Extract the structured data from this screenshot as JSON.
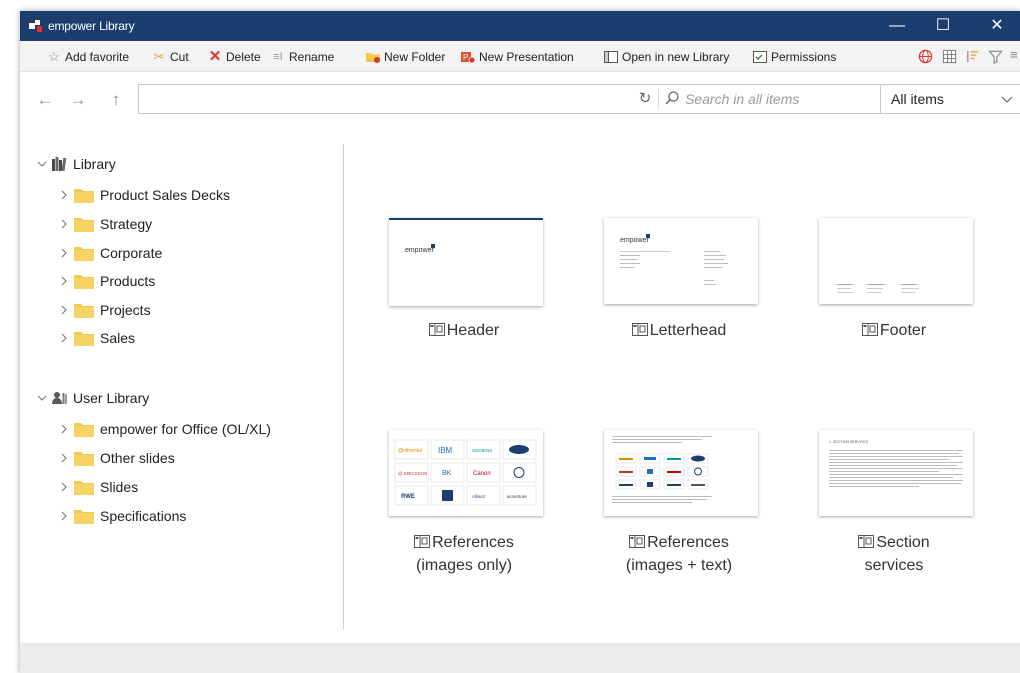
{
  "window": {
    "title": "empower Library"
  },
  "window_controls": {
    "minimize": "—",
    "maximize": "☐",
    "close": "✕"
  },
  "toolbar": {
    "add_favorite": "Add favorite",
    "cut": "Cut",
    "delete": "Delete",
    "rename": "Rename",
    "new_folder": "New Folder",
    "new_presentation": "New Presentation",
    "open_in_new_library": "Open in new Library",
    "permissions": "Permissions"
  },
  "address": {
    "path_value": "",
    "search_placeholder": "Search in all items",
    "filter_value": "All items"
  },
  "tree": {
    "library": {
      "label": "Library",
      "children": [
        "Product Sales Decks",
        "Strategy",
        "Corporate",
        "Products",
        "Projects",
        "Sales"
      ]
    },
    "user_library": {
      "label": "User Library",
      "children": [
        "empower for Office (OL/XL)",
        "Other slides",
        "Slides",
        "Specifications"
      ]
    }
  },
  "tiles": [
    {
      "line1": "Header",
      "line2": ""
    },
    {
      "line1": "Letterhead",
      "line2": ""
    },
    {
      "line1": "Footer",
      "line2": ""
    },
    {
      "line1": "References",
      "line2": "(images only)"
    },
    {
      "line1": "References",
      "line2": "(images + text)"
    },
    {
      "line1": "Section",
      "line2": "services"
    }
  ],
  "thumb_text": {
    "brand": "empower",
    "logos": [
      "@ntinental",
      "IBM",
      "SIEMENS",
      "Ford",
      "@ ERICSSON",
      "BK",
      "Canon",
      "VW",
      "RWE",
      "AXA",
      "Allianz",
      "accenture"
    ],
    "section_heading": "1. SECTION SERVICES"
  },
  "colors": {
    "titlebar": "#1c3e6e",
    "folder": "#f2c94c",
    "accent_red": "#d9342b",
    "statusbar": "#ececec"
  }
}
